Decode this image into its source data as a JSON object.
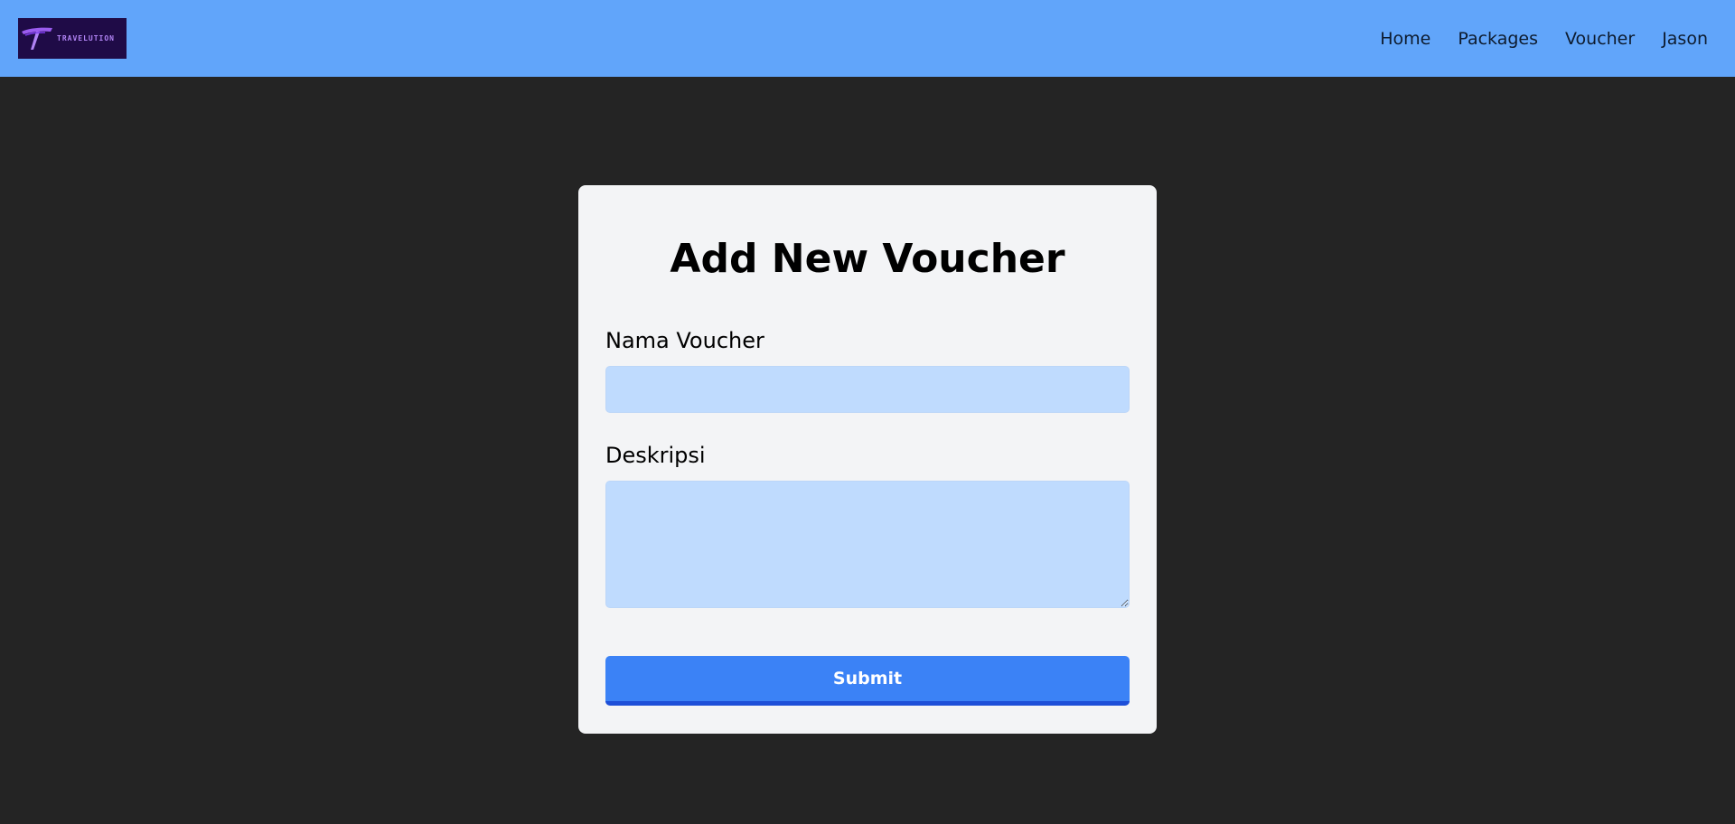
{
  "brand": {
    "logo_text": "TRAVELUTION",
    "logo_icon": "travelution-logo-icon"
  },
  "nav": {
    "items": [
      {
        "label": "Home"
      },
      {
        "label": "Packages"
      },
      {
        "label": "Voucher"
      },
      {
        "label": "Jason"
      }
    ]
  },
  "form": {
    "title": "Add New Voucher",
    "fields": {
      "nama": {
        "label": "Nama Voucher",
        "value": "",
        "placeholder": ""
      },
      "deskripsi": {
        "label": "Deskripsi",
        "value": "",
        "placeholder": ""
      }
    },
    "submit_label": "Submit"
  },
  "colors": {
    "navbar_bg": "#61a5fa",
    "page_bg": "#242424",
    "card_bg": "#f3f4f6",
    "input_bg": "#bfdbfe",
    "button_bg": "#3b82f6",
    "button_border": "#1d4fd8",
    "logo_bg": "#1f0b47"
  }
}
